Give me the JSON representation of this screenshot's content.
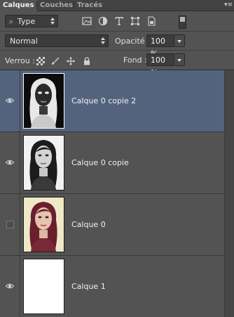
{
  "tabs": [
    {
      "label": "Calques",
      "active": true
    },
    {
      "label": "Couches",
      "active": false
    },
    {
      "label": "Tracés",
      "active": false
    }
  ],
  "filter": {
    "value": "Type",
    "icons": [
      "pixel-filter-icon",
      "adjustment-filter-icon",
      "type-filter-icon",
      "shape-filter-icon",
      "smart-object-filter-icon"
    ]
  },
  "blend": {
    "mode": "Normal",
    "opacity_label": "Opacité :",
    "opacity_value": "100 %"
  },
  "lock": {
    "label": "Verrou :",
    "fill_label": "Fond :",
    "fill_value": "100 %",
    "icons": [
      "lock-transparent-icon",
      "lock-paint-icon",
      "lock-move-icon",
      "lock-all-icon"
    ]
  },
  "layers": [
    {
      "name": "Calque 0 copie 2",
      "visible": true,
      "selected": true,
      "thumb": "inverted-portrait"
    },
    {
      "name": "Calque 0 copie",
      "visible": true,
      "selected": false,
      "thumb": "bw-portrait"
    },
    {
      "name": "Calque 0",
      "visible": false,
      "selected": false,
      "thumb": "color-portrait"
    },
    {
      "name": "Calque 1",
      "visible": true,
      "selected": false,
      "thumb": "white-fill"
    }
  ],
  "colors": {
    "panel": "#535353",
    "selected_row": "#54637d",
    "field": "#3c3c3c"
  }
}
